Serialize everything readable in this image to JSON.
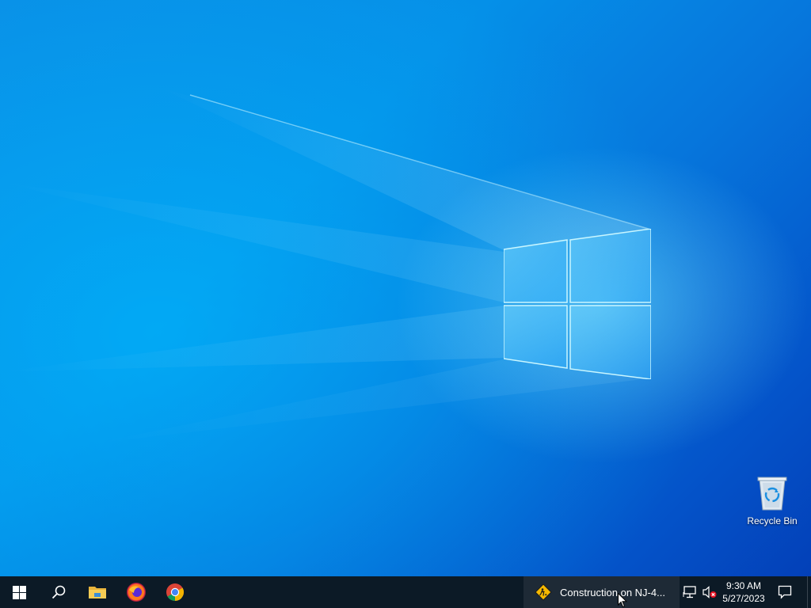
{
  "desktop": {
    "wallpaper": "windows-10-hero-light",
    "icons": [
      {
        "label": "Recycle Bin",
        "icon": "recycle-bin-icon"
      }
    ]
  },
  "taskbar": {
    "pinned": [
      {
        "name": "start-button",
        "icon": "windows-start-icon"
      },
      {
        "name": "search-button",
        "icon": "search-icon"
      },
      {
        "name": "file-explorer-button",
        "icon": "folder-icon"
      },
      {
        "name": "firefox-button",
        "icon": "firefox-icon"
      },
      {
        "name": "chrome-button",
        "icon": "chrome-icon"
      }
    ],
    "notification": {
      "icon": "construction-sign-icon",
      "text": "Construction on NJ-4..."
    },
    "tray": {
      "network_icon": "network-icon",
      "volume_icon": "volume-muted-icon"
    },
    "clock": {
      "time": "9:30 AM",
      "date": "5/27/2023"
    },
    "action_center_icon": "action-center-icon"
  },
  "colors": {
    "taskbar_bg": "#0c1a26",
    "notification_bg": "#1e2a36",
    "desktop_blue": "#0590e8"
  }
}
